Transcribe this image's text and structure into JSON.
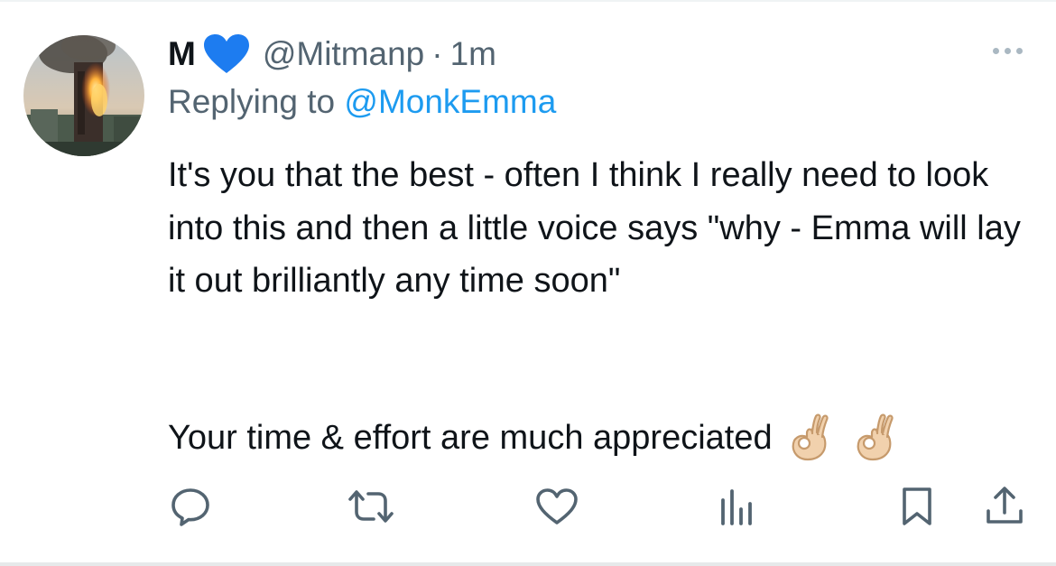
{
  "tweet": {
    "display_name": "M",
    "handle": "@Mitmanp",
    "separator": "·",
    "time": "1m",
    "replying_prefix": "Replying to ",
    "replying_handle": "@MonkEmma",
    "text": "It's you that the best - often I think I really need to look into this and then a little voice says \"why - Emma will lay it out brilliantly any time soon\"",
    "text_line_2": "Your time & effort are much appreciated",
    "emoji": [
      "ok-hand-emoji",
      "ok-hand-emoji"
    ]
  },
  "icons": {
    "verified": "blue-heart-icon",
    "more": "more-options-icon",
    "actions": [
      "reply-icon",
      "retweet-icon",
      "like-icon",
      "views-icon",
      "bookmark-icon",
      "share-icon"
    ]
  },
  "colors": {
    "text": "#0f1419",
    "secondary": "#536471",
    "link": "#1d9bf0",
    "heart": "#1d7cf0",
    "icon": "#536471"
  }
}
